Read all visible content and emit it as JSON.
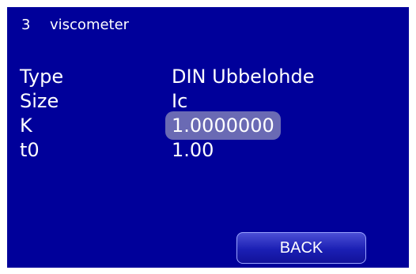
{
  "header": {
    "number": "3",
    "title": "viscometer"
  },
  "params": [
    {
      "label": "Type",
      "value": "DIN Ubbelohde"
    },
    {
      "label": "Size",
      "value": "Ic"
    },
    {
      "label": "K",
      "value": "1.0000000"
    },
    {
      "label": "t0",
      "value": "1.00"
    }
  ],
  "back_label": "BACK",
  "colors": {
    "background": "#00009a",
    "highlight": "#6a6ab4",
    "button": "#1b1fb4"
  }
}
